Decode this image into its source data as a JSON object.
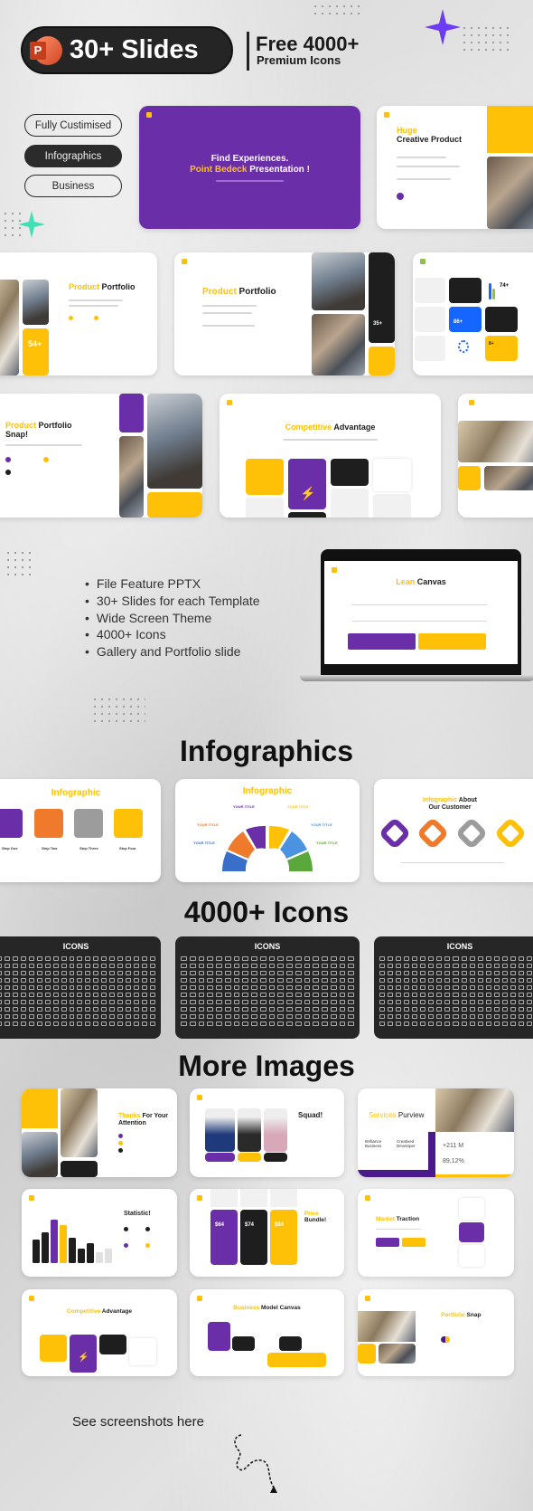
{
  "header": {
    "badge_label": "30+ Slides",
    "ppt_letter": "P",
    "free_line": "Free 4000+",
    "premium_line": "Premium Icons"
  },
  "pills": [
    "Fully Custimised",
    "Infographics",
    "Business"
  ],
  "slides": {
    "cover": {
      "line1": "Find Experiences.",
      "highlight": "Point Bedeck",
      "rest": " Presentation !"
    },
    "huge": {
      "highlight": "Huge",
      "title": "Creative Product"
    },
    "portfolio_a": {
      "highlight": "Product",
      "title": " Portfolio",
      "stat": "54+"
    },
    "portfolio_b": {
      "highlight": "Product",
      "title": " Portfolio",
      "stat": "35+"
    },
    "stats": {
      "stat1": "74+",
      "stat2": "86+",
      "stat3": "8+"
    },
    "snap": {
      "highlight": "Product",
      "title": " Portfolio",
      "title2": "Snap!"
    },
    "competitive": {
      "highlight": "Competitive",
      "title": " Advantage"
    }
  },
  "features": [
    "File Feature PPTX",
    "30+ Slides for each Template",
    "Wide Screen Theme",
    "4000+ Icons",
    "Gallery and Portfolio slide"
  ],
  "laptop": {
    "highlight": "Lean",
    "title": " Canvas"
  },
  "sections": {
    "infographics": "Infographics",
    "icons": "4000+ Icons",
    "more": "More Images"
  },
  "infographics": {
    "puzzle": {
      "title": "Infographic",
      "steps": [
        "Step One",
        "Step Two",
        "Step Three",
        "Step Four"
      ]
    },
    "arc": {
      "title": "Infographic",
      "labels": [
        "YOUR TITLE",
        "YOUR TITLE",
        "YOUR TITLE",
        "YOUR TITLE",
        "YOUR TITLE",
        "YOUR TITLE"
      ]
    },
    "customer": {
      "highlight": "Infographic",
      "title": " About",
      "title2": "Our Customer"
    }
  },
  "icons_label": "ICONS",
  "more": {
    "thanks": {
      "highlight": "Thanks",
      "title": " For Your",
      "title2": "Attention"
    },
    "squad": {
      "title": "Squad!"
    },
    "services": {
      "highlight": "Services",
      "title": " Purview",
      "col1": "Brilliance Business",
      "col2": "Creatived Developer",
      "stat1": "+211 M",
      "stat2": "89,12%"
    },
    "statistic": {
      "title": "Statistic!"
    },
    "price": {
      "highlight": "Price",
      "title": "Bundle!",
      "prices": [
        "$64",
        "$74",
        "$84"
      ]
    },
    "market": {
      "highlight": "Market",
      "title": " Traction"
    },
    "competitive": {
      "highlight": "Competitive",
      "title": " Advantage"
    },
    "canvas": {
      "highlight": "Business",
      "title": " Model Canvas"
    },
    "snap": {
      "highlight": "Portfolio",
      "title": " Snap"
    }
  },
  "footer": {
    "cta": "See screenshots here"
  },
  "colors": {
    "purple": "#6c2eb4",
    "yellow": "#ffc107",
    "dark": "#1e1e1e",
    "accent_star": "#6c3bf5",
    "green_star": "#3fe0b5",
    "blue": "#1565ff"
  }
}
